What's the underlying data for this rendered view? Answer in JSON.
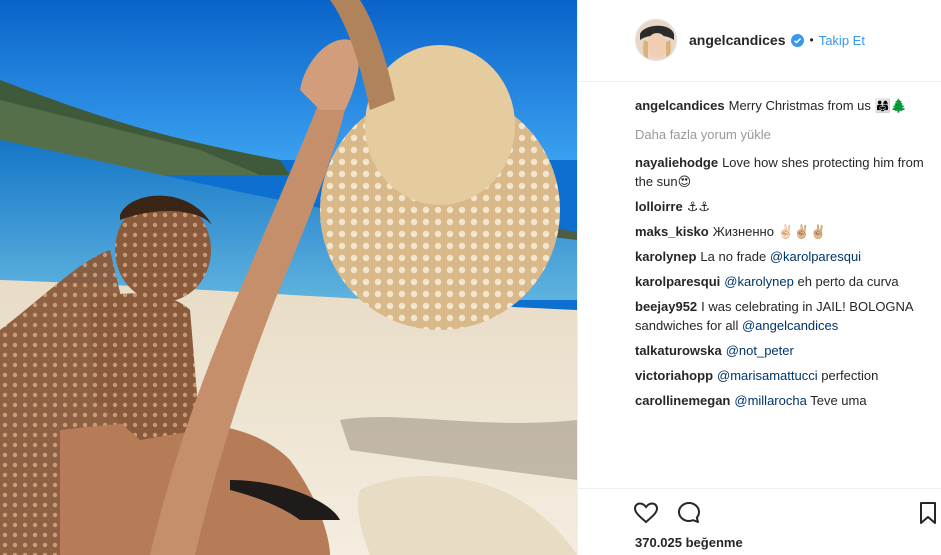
{
  "post": {
    "username": "angelcandices",
    "follow_label": "Takip Et",
    "dot": "•",
    "caption": {
      "user": "angelcandices",
      "text": "Merry Christmas from us 👨‍👩‍👧🌲"
    },
    "load_more": "Daha fazla yorum yükle",
    "comments": [
      {
        "user": "nayaliehodge",
        "text": "Love how shes protecting him from the sun😍",
        "mention": ""
      },
      {
        "user": "lolloirre",
        "text": "⚓⚓",
        "mention": ""
      },
      {
        "user": "maks_kisko",
        "text": "Жизненно ✌🏻✌🏼✌🏼",
        "mention": ""
      },
      {
        "user": "karolynep",
        "text": "La no frade",
        "mention": "@karolparesqui"
      },
      {
        "user": "karolparesqui",
        "text": "eh perto da curva",
        "mention": "@karolynep",
        "mention_first": true
      },
      {
        "user": "beejay952",
        "text": "I was celebrating in JAIL! BOLOGNA sandwiches for all",
        "mention": "@angelcandices",
        "mention_after": true
      },
      {
        "user": "talkaturowska",
        "text": "",
        "mention": "@not_peter"
      },
      {
        "user": "victoriahopp",
        "text": "perfection",
        "mention": "@marisamattucci",
        "mention_first": true
      },
      {
        "user": "carollinemegan",
        "text": "Teve uma",
        "mention": "@millarocha",
        "mention_first": true
      }
    ],
    "likes": "370.025 beğenme"
  },
  "icons": {
    "like": "heart-icon",
    "comment": "comment-bubble-icon",
    "save": "bookmark-icon",
    "verified": "verified-badge-icon"
  },
  "colors": {
    "link": "#003569",
    "follow": "#3897f0",
    "muted": "#999999"
  }
}
